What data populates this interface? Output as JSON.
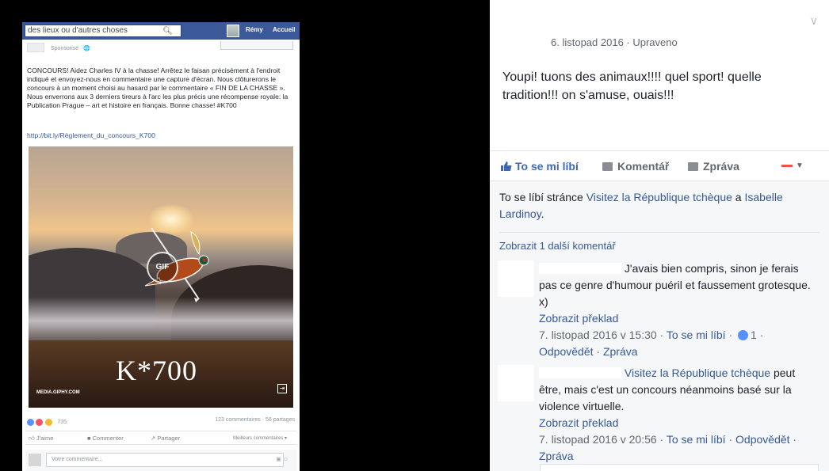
{
  "left_shot": {
    "search_text": "des lieux ou d'autres choses",
    "user": "Rémy",
    "home": "Accueil",
    "sponsored": "Sponsorisé · 🌐",
    "post_text": "CONCOURS! Aidez Charles IV à la chasse! Arrêtez le faisan précisément à l'endroit indiqué et envoyez-nous en commentaire une capture d'écran. Nous clôturerons le concours à un moment choisi au hasard par le commentaire « FIN DE LA CHASSE ». Nous enverrons aux 3 derniers tireurs à l'arc les plus précis une récompense royale: la Publication Prague – art et histoire en français. Bonne chasse! #K700",
    "post_link": "http://bit.ly/Règlement_du_concours_K700",
    "gif_label": "GIF",
    "k700": "K*700",
    "media_credit": "MEDIA.GIPHY.COM",
    "reaction_count": "735",
    "share_counts": "123 commentaires · 56 partages",
    "like": "J'aime",
    "comment": "Commenter",
    "share": "Partager",
    "top_comments": "Meilleurs commentaires ▾",
    "comment_placeholder": "Votre commentaire...",
    "colors": {
      "fb_blue": "#3b5998"
    }
  },
  "panel": {
    "post_meta": "6. listopad 2016 · Upraveno",
    "post_body": "Youpi! tuons des animaux!!!! quel sport! quelle tradition!!! on s'amuse, ouais!!!",
    "like_btn": "To se mi líbí",
    "comment_btn": "Komentář",
    "share_btn": "Zpráva",
    "likes_prefix": "To se líbí stránce ",
    "likes_page": "Visitez la République tchèque",
    "likes_and": " a ",
    "likes_person": "Isabelle Lardinoy",
    "likes_suffix": ".",
    "more_comments": "Zobrazit 1 další komentář",
    "comments": [
      {
        "author": "",
        "text": "J'avais bien compris, sinon je ferais pas ce genre d'humour puéril et faussement grotesque. x)",
        "translate": "Zobrazit překlad",
        "time": "7. listopad 2016 v 15:30",
        "like": "To se mi líbí",
        "reaction_count": "1",
        "reply": "Odpovědět",
        "message": "Zpráva"
      },
      {
        "author": "Visitez la République tchèque",
        "text": "peut être, mais c'est un concours néanmoins basé sur la violence virtuelle.",
        "translate": "Zobrazit překlad",
        "time": "7. listopad 2016 v 20:56",
        "like": "To se mi líbí",
        "reply": "Odpovědět",
        "message": "Zpráva"
      }
    ],
    "colors": {
      "link": "#365899",
      "accent": "#4267b2",
      "bg": "#f6f7f9"
    }
  }
}
